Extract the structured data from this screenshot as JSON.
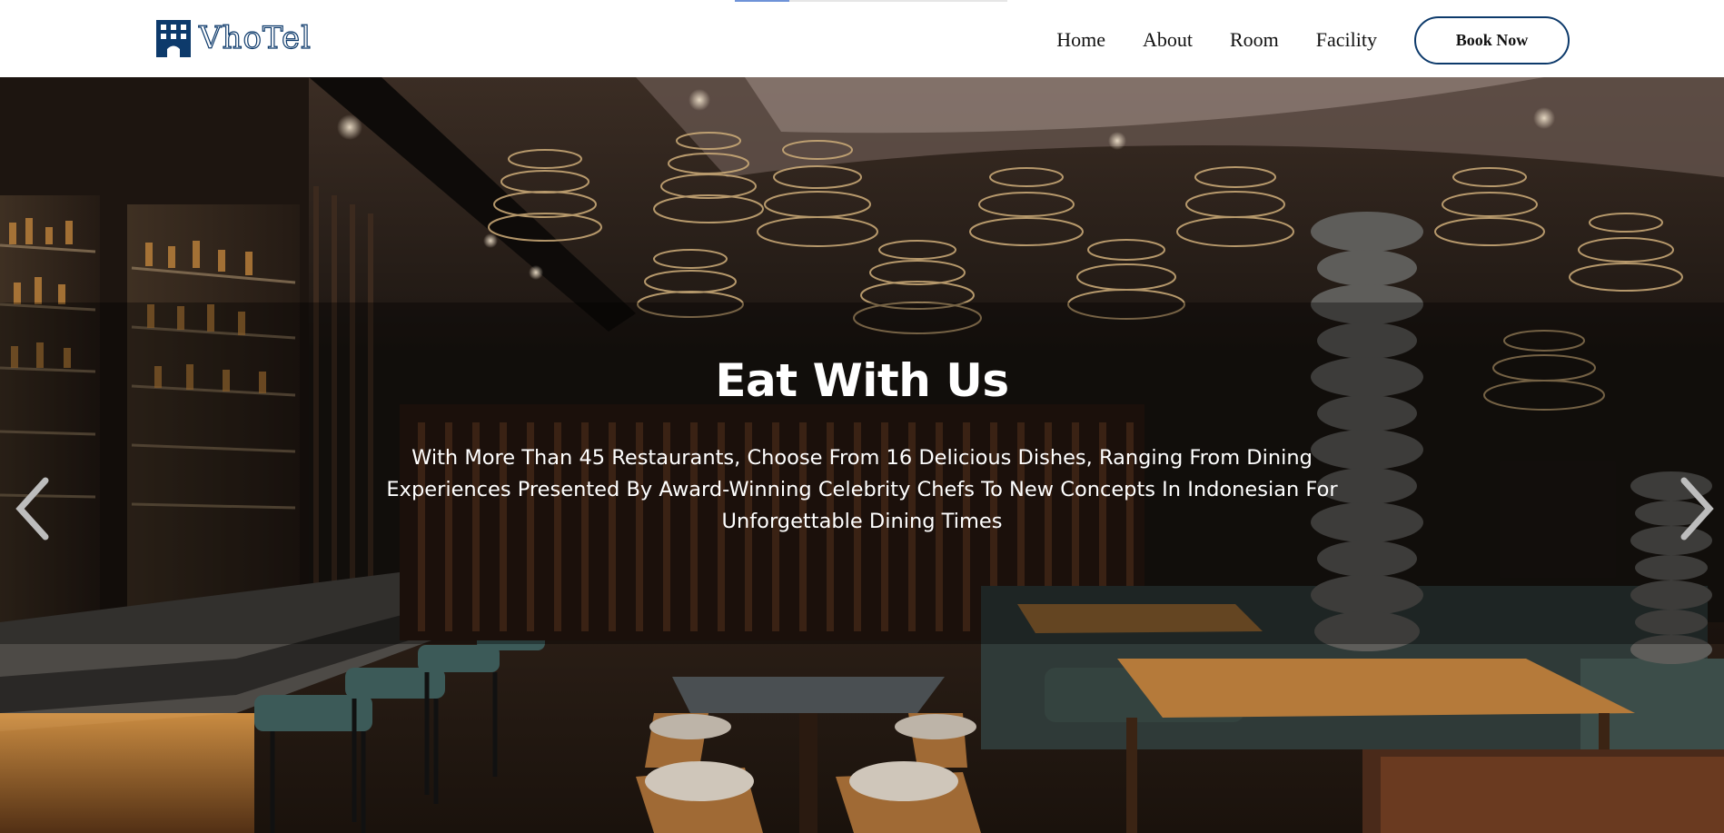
{
  "brand": {
    "name": "VhoTel",
    "icon": "hotel-building-icon",
    "color": "#0d3a6b"
  },
  "page_load_progress": 0.2,
  "nav": {
    "links": [
      {
        "label": "Home"
      },
      {
        "label": "About"
      },
      {
        "label": "Room"
      },
      {
        "label": "Facility"
      }
    ],
    "book_label": "Book Now"
  },
  "hero": {
    "title": "Eat With Us",
    "text": "With More Than 45 Restaurants, Choose From 16 Delicious Dishes, Ranging From Dining Experiences Presented By Award-Winning Celebrity Chefs To New Concepts In Indonesian For Unforgettable Dining Times",
    "prev_icon": "chevron-left-icon",
    "next_icon": "chevron-right-icon"
  }
}
